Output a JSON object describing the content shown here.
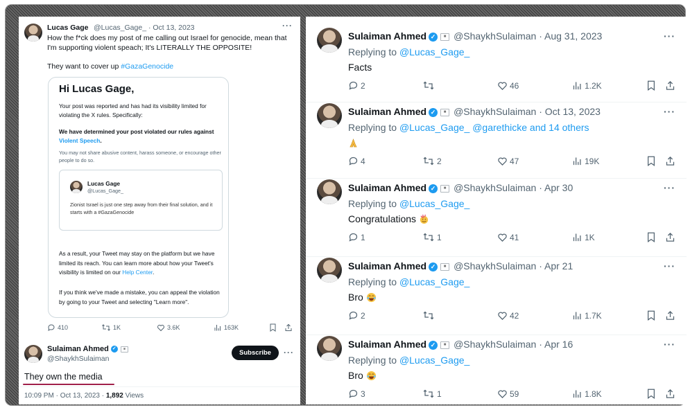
{
  "left": {
    "author_name": "Lucas Gage",
    "author_meta": "@Lucas_Gage_ · Oct 13, 2023",
    "text": "How the f*ck does my post of me calling out Israel for genocide, mean that I'm supporting violent speach; It's LITERALLY THE OPPOSITE!",
    "text2_prefix": "They want to cover up ",
    "text2_hashtag": "#GazaGenocide",
    "card": {
      "heading": "Hi Lucas Gage,",
      "p1": "Your post was reported and has had its visibility limited for violating the X rules. Specifically:",
      "p2_prefix": "We have determined your post violated our rules against ",
      "p2_link": "Violent Speech",
      "p2_suffix": ".",
      "p3": "You may not share abusive content, harass someone, or encourage other people to do so.",
      "quote_name": "Lucas Gage",
      "quote_handle": "@Lucas_Gage_",
      "quote_text": "Zionist Israel is just one step away from their final solution, and it starts with a #GazaGenocide",
      "p4_prefix": "As a result, your Tweet may stay on the platform but we have limited its reach. You can learn more about how your Tweet's visibility is limited on our ",
      "p4_link": "Help Center",
      "p4_suffix": ".",
      "p5": "If you think we've made a mistake, you can appeal the violation by going to your Tweet and selecting \"Learn more\"."
    },
    "actions": {
      "reply": "410",
      "retweet": "1K",
      "like": "3.6K",
      "views": "163K"
    },
    "reply_author": "Sulaiman Ahmed",
    "reply_handle": "@ShaykhSulaiman",
    "subscribe_label": "Subscribe",
    "reply_text": "They own the media",
    "footer_time": "10:09 PM · Oct 13, 2023 · ",
    "footer_views": "1,892",
    "footer_views_label": " Views"
  },
  "right": {
    "tweets": [
      {
        "name": "Sulaiman Ahmed",
        "meta": "@ShaykhSulaiman · Aug 31, 2023",
        "replying_prefix": "Replying to ",
        "replying_to": "@Lucas_Gage_",
        "body": "Facts",
        "emoji": "",
        "reply": "2",
        "retweet": "",
        "like": "46",
        "views": "1.2K"
      },
      {
        "name": "Sulaiman Ahmed",
        "meta": "@ShaykhSulaiman · Oct 13, 2023",
        "replying_prefix": "Replying to ",
        "replying_to": "@Lucas_Gage_ @garethicke and 14 others",
        "body": "",
        "emoji": "pray",
        "reply": "4",
        "retweet": "2",
        "like": "47",
        "views": "19K"
      },
      {
        "name": "Sulaiman Ahmed",
        "meta": "@ShaykhSulaiman · Apr 30",
        "replying_prefix": "Replying to ",
        "replying_to": "@Lucas_Gage_",
        "body": "Congratulations",
        "emoji": "party",
        "reply": "1",
        "retweet": "1",
        "like": "41",
        "views": "1K"
      },
      {
        "name": "Sulaiman Ahmed",
        "meta": "@ShaykhSulaiman · Apr 21",
        "replying_prefix": "Replying to ",
        "replying_to": "@Lucas_Gage_",
        "body": "Bro",
        "emoji": "laugh",
        "reply": "2",
        "retweet": "",
        "like": "42",
        "views": "1.7K"
      },
      {
        "name": "Sulaiman Ahmed",
        "meta": "@ShaykhSulaiman · Apr 16",
        "replying_prefix": "Replying to ",
        "replying_to": "@Lucas_Gage_",
        "body": "Bro",
        "emoji": "laugh",
        "reply": "3",
        "retweet": "1",
        "like": "59",
        "views": "1.8K"
      }
    ]
  },
  "colors": {
    "accent": "#1d9bf0",
    "text": "#0f1419",
    "muted": "#536471",
    "underline": "#a0204a"
  }
}
